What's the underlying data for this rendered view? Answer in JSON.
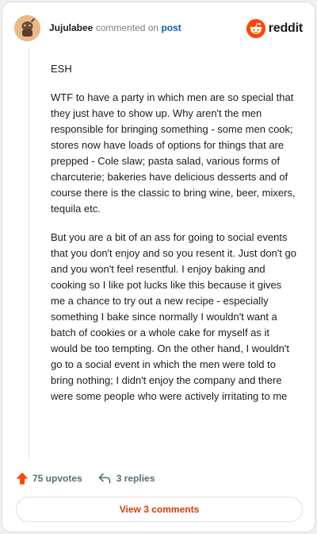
{
  "header": {
    "username": "Jujulabee",
    "action_text": "commented on",
    "post_link": "post",
    "logo_text": "reddit",
    "brand_color": "#ff4500"
  },
  "comment": {
    "paragraphs": [
      "ESH",
      "WTF to have a party in which men are so special that they just have to show up. Why aren't the men responsible for bringing something - some men cook; stores now have loads of options for things that are prepped - Cole slaw; pasta salad, various forms of charcuterie; bakeries have delicious desserts and of course there is the classic to bring wine, beer, mixers, tequila etc.",
      "But you are a bit of an ass for going to social events that you don't enjoy and so you resent it. Just don't go and you won't feel resentful. I enjoy baking and cooking so I like pot lucks like this because it gives me a chance to try out a new recipe - especially something I bake since normally I wouldn't want a batch of cookies or a whole cake for myself as it would be too tempting. On the other hand, I wouldn't go to a social event in which the men were told to bring nothing; I didn't enjoy the company and there were some people who were actively irritating to me"
    ]
  },
  "actions": {
    "upvotes": "75 upvotes",
    "replies": "3 replies",
    "upvote_icon": "upvote-arrow-icon",
    "reply_icon": "reply-arrow-icon"
  },
  "footer": {
    "view_comments": "View 3 comments"
  }
}
